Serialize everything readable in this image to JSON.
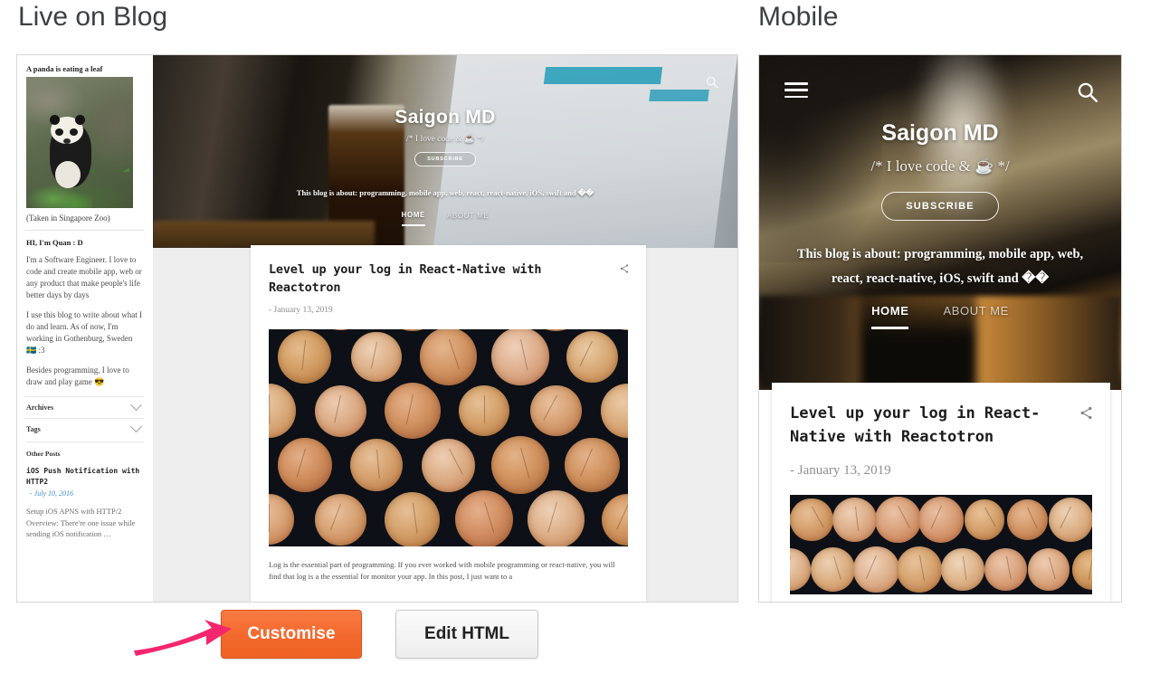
{
  "headings": {
    "live_on_blog": "Live on Blog",
    "mobile": "Mobile"
  },
  "blog": {
    "title": "Saigon MD",
    "tagline": "/* I love code & ☕ */",
    "subscribe_label": "SUBSCRIBE",
    "about_line": "This blog is about: programming, mobile app, web, react, react-native, iOS, swift and ��",
    "about_line_mobile_1": "This blog is about: programming, mobile app, web,",
    "about_line_mobile_2": "react, react-native, iOS, swift and ��",
    "nav": [
      {
        "label": "HOME",
        "active": true
      },
      {
        "label": "ABOUT ME",
        "active": false
      }
    ],
    "search_icon": "search-icon",
    "menu_icon": "hamburger-menu-icon",
    "share_icon": "share-icon"
  },
  "sidebar": {
    "panda_caption_top": "A panda is eating a leaf",
    "panda_caption_bottom": "(Taken in Singapore Zoo)",
    "greeting": "HI, I'm Quan : D",
    "paragraphs": [
      "I'm a Software Engineer. I love to code and create mobile app, web or any product that make people's life better days by days",
      "I use this blog to write about what I do and learn. As of now, I'm working in Gothenburg, Sweden 🇸🇪 :3",
      "Besides programming, I love to draw and play game 😎"
    ],
    "accordions": [
      {
        "label": "Archives",
        "icon": "chevron-down-icon"
      },
      {
        "label": "Tags",
        "icon": "chevron-down-icon"
      }
    ],
    "other_posts_label": "Other Posts",
    "other_posts": [
      {
        "title": "iOS Push Notification with HTTP2",
        "date": "- July 10, 2016",
        "excerpt": "Setup iOS APNS with HTTP/2 Overview: There're one issue while sending iOS notification …"
      }
    ]
  },
  "post": {
    "title": "Level up your log in React-Native with Reactotron",
    "date": "- January 13, 2019",
    "body": "Log is the essential part of programming. If you ever worked with mobile programming or react-native, you will find that log is a the essential for monitor your app. In this post, I just want to a"
  },
  "buttons": {
    "customise": "Customise",
    "edit_html": "Edit HTML"
  },
  "annotation": {
    "arrow": "pink-arrow-pointing-right",
    "arrow_color": "#f5256e"
  },
  "colors": {
    "accent_orange": "#f2682c",
    "arrow_pink": "#f5256e",
    "heading_gray": "#3c4043",
    "panel_border": "#d6d6d6",
    "blog_bg": "#eeeeee"
  }
}
